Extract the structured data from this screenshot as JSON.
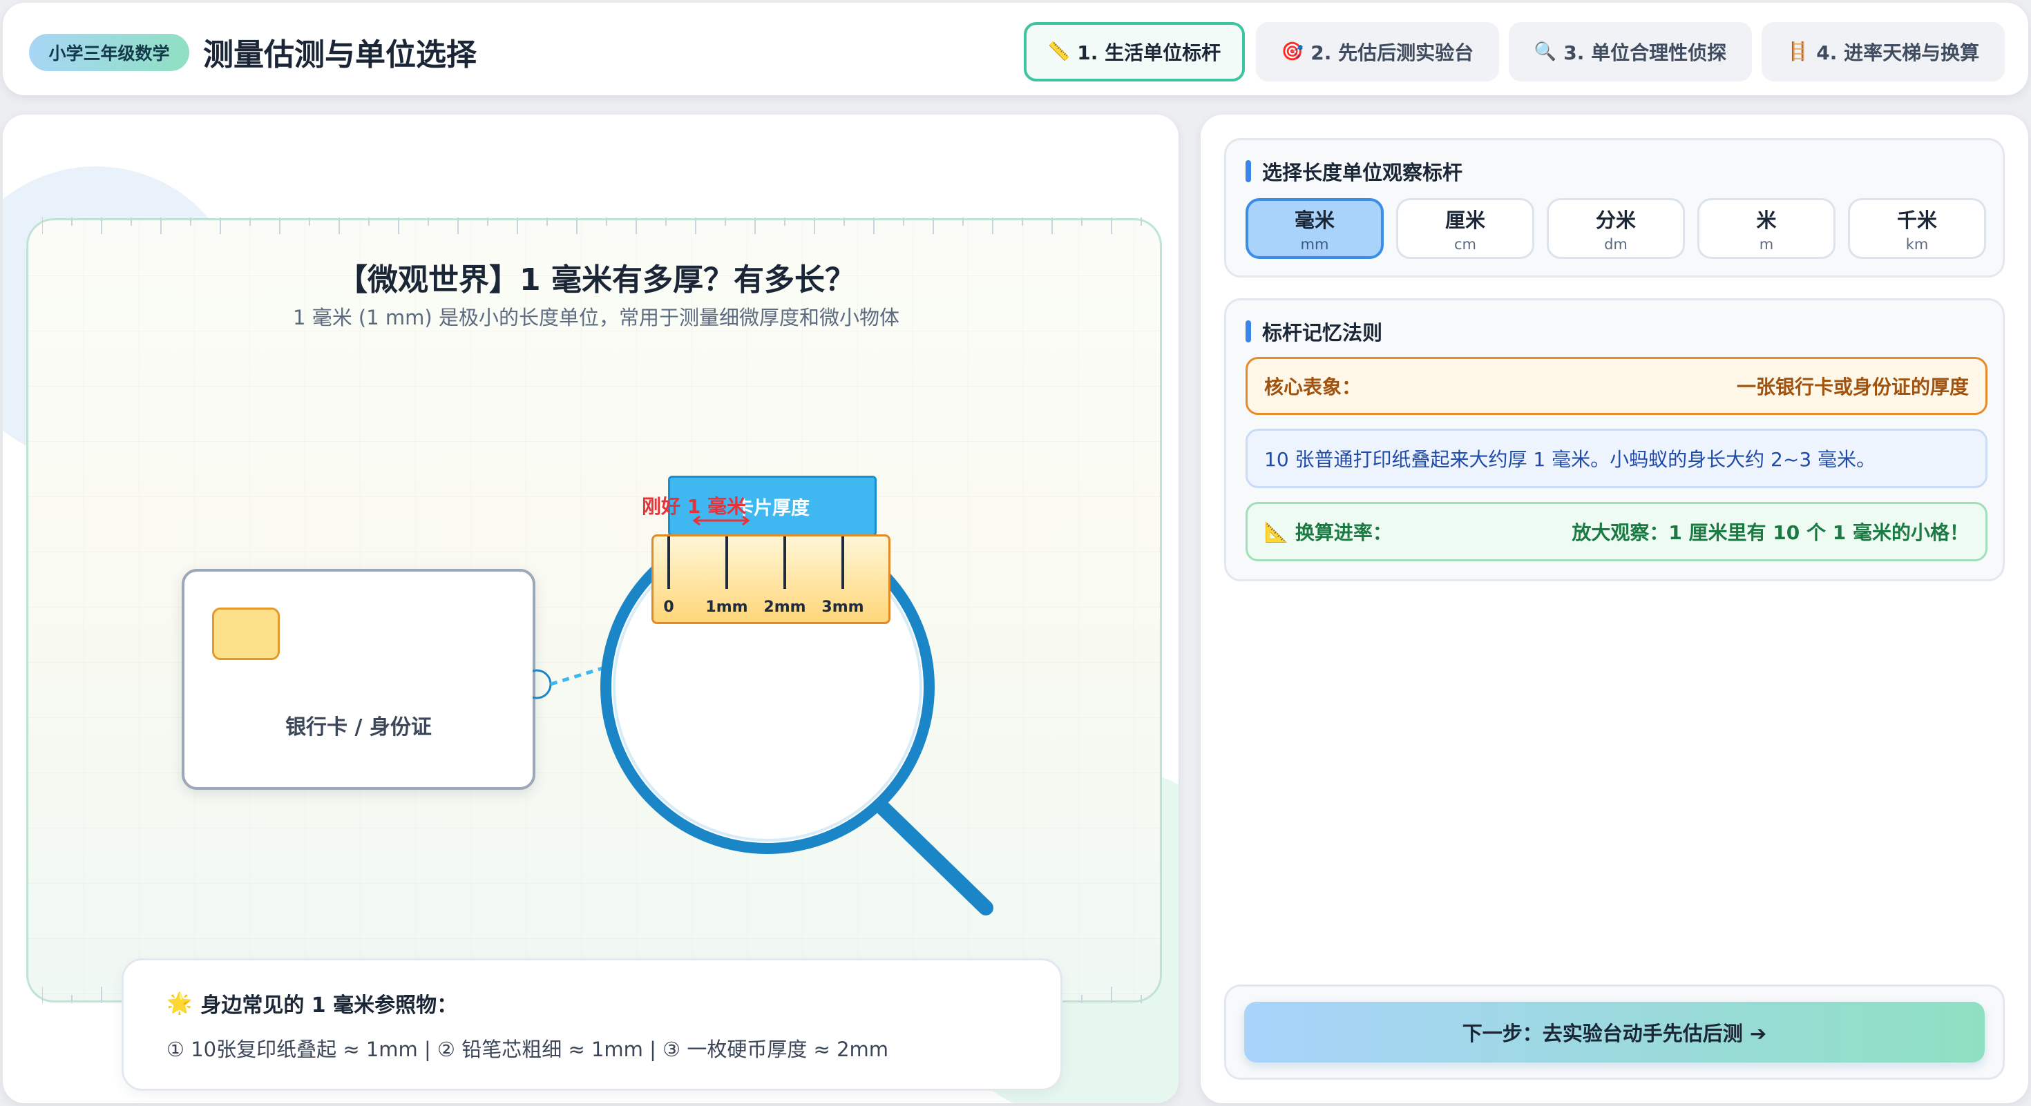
{
  "header": {
    "grade_badge": "小学三年级数学",
    "title": "测量估测与单位选择",
    "tabs": [
      {
        "icon": "📏",
        "label": "1. 生活单位标杆",
        "active": true
      },
      {
        "icon": "🎯",
        "label": "2. 先估后测实验台",
        "active": false
      },
      {
        "icon": "🔍",
        "label": "3. 单位合理性侦探",
        "active": false
      },
      {
        "icon": "🪜",
        "label": "4. 进率天梯与换算",
        "active": false
      }
    ]
  },
  "stage": {
    "title": "【微观世界】1 毫米有多厚？有多长？",
    "subtitle": "1 毫米 (1 mm) 是极小的长度单位，常用于测量细微厚度和微小物体",
    "card_label": "银行卡 / 身份证",
    "zoom_label": "卡片厚度",
    "zoom_red_label": "刚好 1 毫米",
    "ruler_ticks": [
      "0",
      "1mm",
      "2mm",
      "3mm"
    ]
  },
  "reference": {
    "icon": "🌟",
    "title": "身边常见的 1 毫米参照物：",
    "text": "① 10张复印纸叠起 ≈ 1mm | ② 铅笔芯粗细 ≈ 1mm | ③ 一枚硬币厚度 ≈ 2mm"
  },
  "unit_selector": {
    "title": "选择长度单位观察标杆",
    "units": [
      {
        "name": "毫米",
        "abbr": "mm",
        "active": true
      },
      {
        "name": "厘米",
        "abbr": "cm",
        "active": false
      },
      {
        "name": "分米",
        "abbr": "dm",
        "active": false
      },
      {
        "name": "米",
        "abbr": "m",
        "active": false
      },
      {
        "name": "千米",
        "abbr": "km",
        "active": false
      }
    ]
  },
  "rules": {
    "title": "标杆记忆法则",
    "core_label": "核心表象：",
    "core_value": "一张银行卡或身份证的厚度",
    "info": "10 张普通打印纸叠起来大约厚 1 毫米。小蚂蚁的身长大约 2~3 毫米。",
    "conv_icon": "📐",
    "conv_label": "换算进率：",
    "conv_value": "放大观察：1 厘米里有 10 个 1 毫米的小格！"
  },
  "next_button": "下一步：去实验台动手先估后测 ➔",
  "colors": {
    "accent_green": "#3fc4a0",
    "accent_blue": "#3a86e8",
    "magnifier_blue": "#1a86c8",
    "alert_red": "#e8323a",
    "core_orange": "#e58b28"
  }
}
